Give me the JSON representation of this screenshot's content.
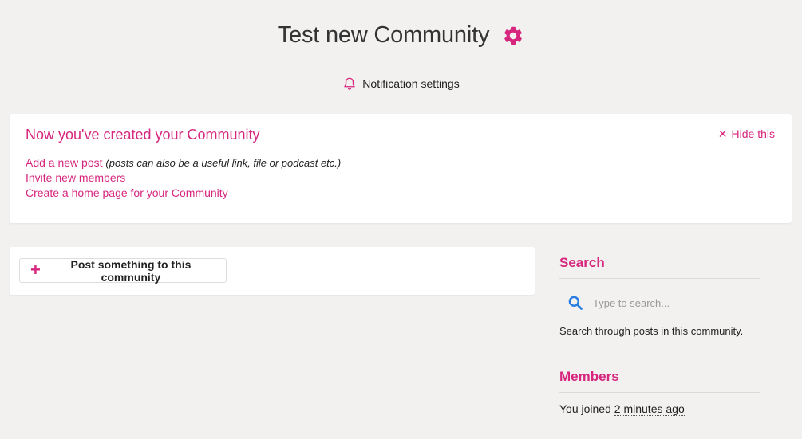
{
  "header": {
    "title": "Test new Community",
    "settings_icon": "gear-icon",
    "notification_label": "Notification settings",
    "notification_icon": "bell-icon"
  },
  "welcome": {
    "heading": "Now you've created your Community",
    "hide_label": "Hide this",
    "add_post_label": "Add a new post",
    "add_post_note": "(posts can also be a useful link, file or podcast etc.)",
    "invite_label": "Invite new members",
    "homepage_label": "Create a home page for your Community"
  },
  "post": {
    "button_label": "Post something to this community"
  },
  "sidebar": {
    "search_heading": "Search",
    "search_placeholder": "Type to search...",
    "search_help": "Search through posts in this community.",
    "members_heading": "Members",
    "joined_prefix": "You joined ",
    "joined_time": "2 minutes ago"
  },
  "colors": {
    "accent": "#d6267e",
    "search_icon": "#2a7de1",
    "background": "#f2f1f0"
  }
}
